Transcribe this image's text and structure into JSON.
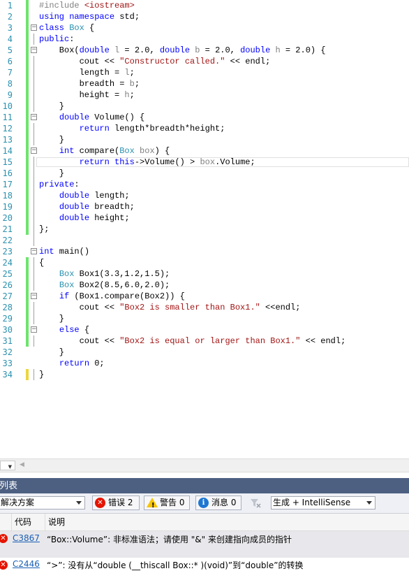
{
  "editor": {
    "lines": [
      {
        "n": "1",
        "bar": "green",
        "fold": "",
        "html": "<span class=\"pp\">#include</span> <span class=\"inc\">&lt;iostream&gt;</span>"
      },
      {
        "n": "2",
        "bar": "green",
        "fold": "",
        "html": "<span class=\"kw\">using namespace</span> std;"
      },
      {
        "n": "3",
        "bar": "green",
        "fold": "−",
        "html": "<span class=\"kw\">class</span> <span class=\"ty\">Box</span> {"
      },
      {
        "n": "4",
        "bar": "green",
        "fold": "",
        "html": "<span class=\"kw\">public</span>:"
      },
      {
        "n": "5",
        "bar": "green",
        "fold": "−",
        "html": "    Box(<span class=\"kw\">double</span> <span class=\"pr\">l</span> = 2.0, <span class=\"kw\">double</span> <span class=\"pr\">b</span> = 2.0, <span class=\"kw\">double</span> <span class=\"pr\">h</span> = 2.0) {"
      },
      {
        "n": "6",
        "bar": "green",
        "fold": "",
        "html": "        cout &lt;&lt; <span class=\"st\">\"Constructor called.\"</span> &lt;&lt; endl;"
      },
      {
        "n": "7",
        "bar": "green",
        "fold": "",
        "html": "        length = <span class=\"pr\">l</span>;"
      },
      {
        "n": "8",
        "bar": "green",
        "fold": "",
        "html": "        breadth = <span class=\"pr\">b</span>;"
      },
      {
        "n": "9",
        "bar": "green",
        "fold": "",
        "html": "        height = <span class=\"pr\">h</span>;"
      },
      {
        "n": "10",
        "bar": "green",
        "fold": "",
        "html": "    }"
      },
      {
        "n": "11",
        "bar": "green",
        "fold": "−",
        "html": "    <span class=\"kw\">double</span> Volume() {"
      },
      {
        "n": "12",
        "bar": "green",
        "fold": "",
        "html": "        <span class=\"kw\">return</span> length*breadth*height;"
      },
      {
        "n": "13",
        "bar": "green",
        "fold": "",
        "html": "    }"
      },
      {
        "n": "14",
        "bar": "green",
        "fold": "−",
        "html": "    <span class=\"kw\">int</span> compare(<span class=\"ty\">Box</span> <span class=\"pr\">box</span>) {"
      },
      {
        "n": "15",
        "bar": "green",
        "fold": "",
        "html": "        <span class=\"kw\">return</span> <span class=\"kw\">this</span>-&gt;Volume() &gt; <span class=\"pr\">box</span>.Volume;",
        "hl": true
      },
      {
        "n": "16",
        "bar": "green",
        "fold": "",
        "html": "    }"
      },
      {
        "n": "17",
        "bar": "green",
        "fold": "",
        "html": "<span class=\"kw\">private</span>:"
      },
      {
        "n": "18",
        "bar": "green",
        "fold": "",
        "html": "    <span class=\"kw\">double</span> length;"
      },
      {
        "n": "19",
        "bar": "green",
        "fold": "",
        "html": "    <span class=\"kw\">double</span> breadth;"
      },
      {
        "n": "20",
        "bar": "green",
        "fold": "",
        "html": "    <span class=\"kw\">double</span> height;"
      },
      {
        "n": "21",
        "bar": "green",
        "fold": "",
        "html": "};"
      },
      {
        "n": "22",
        "bar": "",
        "fold": "",
        "html": ""
      },
      {
        "n": "23",
        "bar": "",
        "fold": "−",
        "html": "<span class=\"kw\">int</span> main()"
      },
      {
        "n": "24",
        "bar": "green",
        "fold": "",
        "html": "{"
      },
      {
        "n": "25",
        "bar": "green",
        "fold": "",
        "html": "    <span class=\"ty\">Box</span> Box1(3.3,1.2,1.5);"
      },
      {
        "n": "26",
        "bar": "green",
        "fold": "",
        "html": "    <span class=\"ty\">Box</span> Box2(8.5,6.0,2.0);"
      },
      {
        "n": "27",
        "bar": "green",
        "fold": "−",
        "html": "    <span class=\"kw\">if</span> (Box1.compare(Box2)) {"
      },
      {
        "n": "28",
        "bar": "green",
        "fold": "",
        "html": "        cout &lt;&lt; <span class=\"st\">\"Box2 is smaller than Box1.\"</span> &lt;&lt;endl;"
      },
      {
        "n": "29",
        "bar": "green",
        "fold": "",
        "html": "    }"
      },
      {
        "n": "30",
        "bar": "green",
        "fold": "−",
        "html": "    <span class=\"kw\">else</span> {"
      },
      {
        "n": "31",
        "bar": "green",
        "fold": "",
        "html": "        cout &lt;&lt; <span class=\"st\">\"Box2 is equal or larger than Box1.\"</span> &lt;&lt; endl;"
      },
      {
        "n": "32",
        "bar": "",
        "fold": "",
        "html": "    }"
      },
      {
        "n": "33",
        "bar": "",
        "fold": "",
        "html": "    <span class=\"kw\">return</span> 0;"
      },
      {
        "n": "34",
        "bar": "yellow",
        "fold": "",
        "html": "}"
      }
    ]
  },
  "panel": {
    "title": "列表",
    "scope": "解决方案",
    "errors_label": "错误 2",
    "warnings_label": "警告 0",
    "messages_label": "消息 0",
    "build_filter": "生成 + IntelliSense",
    "col_code": "代码",
    "col_desc": "说明",
    "rows": [
      {
        "code": "C3867",
        "desc": "“Box::Volume”: 非标准语法；请使用 \"&\" 来创建指向成员的指针"
      },
      {
        "code": "C2446",
        "desc": "“>”: 没有从“double (__thiscall Box::* )(void)”到“double”的转换"
      }
    ]
  }
}
